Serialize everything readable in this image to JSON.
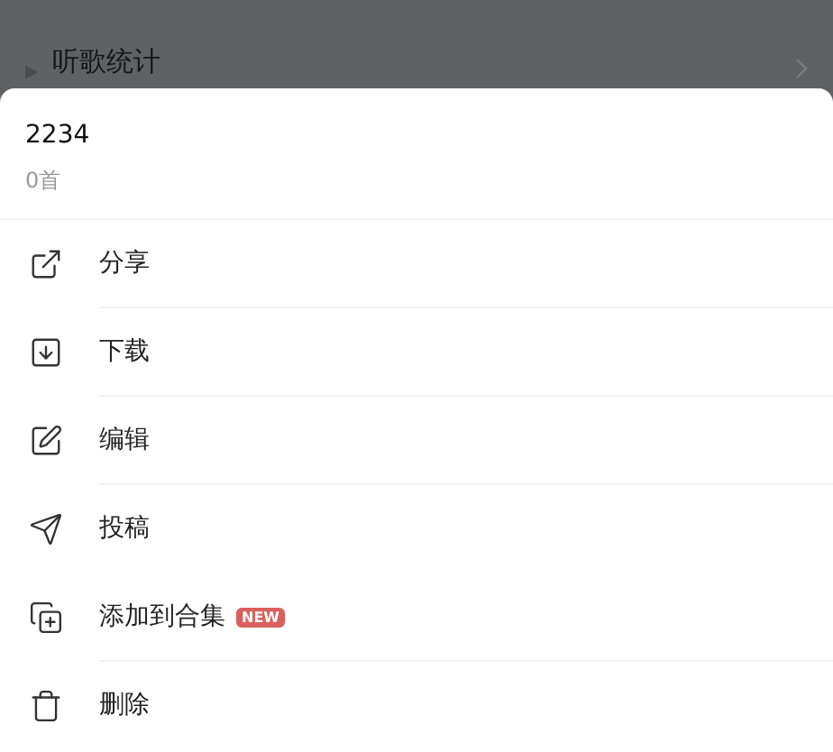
{
  "background_row": {
    "label": "听歌统计"
  },
  "sheet": {
    "title": "2234",
    "subtitle": "0首",
    "items": [
      {
        "kind": "share",
        "label": "分享",
        "divider_below": true
      },
      {
        "kind": "download",
        "label": "下载",
        "divider_below": true
      },
      {
        "kind": "edit",
        "label": "编辑",
        "divider_below": true
      },
      {
        "kind": "submit",
        "label": "投稿",
        "divider_below": false
      },
      {
        "kind": "collection",
        "label": "添加到合集",
        "badge": "NEW",
        "divider_below": true
      },
      {
        "kind": "delete",
        "label": "删除",
        "divider_below": false
      }
    ]
  }
}
